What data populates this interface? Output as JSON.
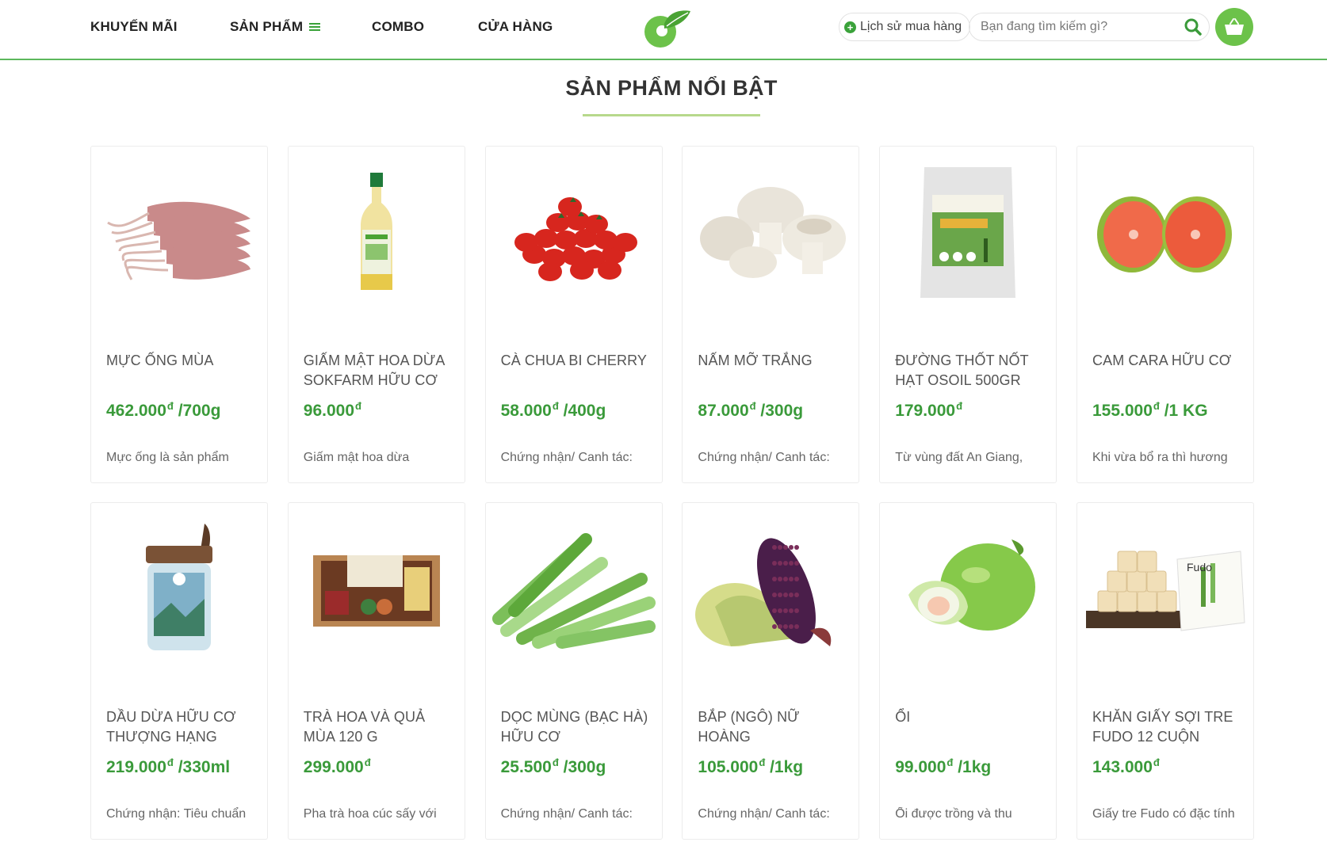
{
  "nav": {
    "promotions": "KHUYẾN MÃI",
    "products": "SẢN PHẨM",
    "combo": "COMBO",
    "stores": "CỬA HÀNG"
  },
  "header": {
    "history_label": "Lịch sử mua hàng",
    "search_placeholder": "Bạn đang tìm kiếm gì?",
    "accent_color": "#6cc24a"
  },
  "section": {
    "title": "SẢN PHẨM NỔI BẬT"
  },
  "currency_symbol": "đ",
  "products": [
    {
      "name": "MỰC ỐNG MÙA",
      "price": "462.000",
      "unit": " /700g",
      "desc": "Mực ống là sản phẩm",
      "image": "squid"
    },
    {
      "name": "GIẤM MẬT HOA DỪA SOKFARM HỮU CƠ",
      "price": "96.000",
      "unit": "",
      "desc": "Giấm mật hoa dừa",
      "image": "vinegar-bottle"
    },
    {
      "name": "CÀ CHUA BI CHERRY",
      "price": "58.000",
      "unit": " /400g",
      "desc": "Chứng nhận/ Canh tác:",
      "image": "cherry-tomatoes"
    },
    {
      "name": "NẤM MỠ TRẮNG",
      "price": "87.000",
      "unit": " /300g",
      "desc": "Chứng nhận/ Canh tác:",
      "image": "white-mushrooms"
    },
    {
      "name": "ĐƯỜNG THỐT NỐT HẠT OSOIL 500GR",
      "price": "179.000",
      "unit": "",
      "desc": "Từ vùng đất An Giang,",
      "image": "sugar-bag"
    },
    {
      "name": "CAM CARA HỮU CƠ",
      "price": "155.000",
      "unit": " /1 KG",
      "desc": "Khi vừa bổ ra thì hương",
      "image": "cara-orange"
    },
    {
      "name": "DẦU DỪA HỮU CƠ THƯỢNG HẠNG",
      "price": "219.000",
      "unit": " /330ml",
      "desc": "Chứng nhận: Tiêu chuẩn",
      "image": "coconut-oil-jar"
    },
    {
      "name": "TRÀ HOA VÀ QUẢ MÙA 120 G",
      "price": "299.000",
      "unit": "",
      "desc": "Pha trà hoa cúc sấy với",
      "image": "tea-box"
    },
    {
      "name": "DỌC MÙNG (BẠC HÀ) HỮU CƠ",
      "price": "25.500",
      "unit": " /300g",
      "desc": "Chứng nhận/ Canh tác:",
      "image": "taro-stems"
    },
    {
      "name": "BẮP (NGÔ) NỮ HOÀNG",
      "price": "105.000",
      "unit": " /1kg",
      "desc": "Chứng nhận/ Canh tác:",
      "image": "purple-corn"
    },
    {
      "name": "ỔI",
      "price": "99.000",
      "unit": " /1kg",
      "desc": "Ổi được trồng và thu",
      "image": "guava"
    },
    {
      "name": "KHĂN GIẤY SỢI TRE FUDO 12 CUỘN",
      "price": "143.000",
      "unit": "",
      "desc": "Giấy tre Fudo có đặc tính",
      "image": "bamboo-tissue"
    }
  ]
}
